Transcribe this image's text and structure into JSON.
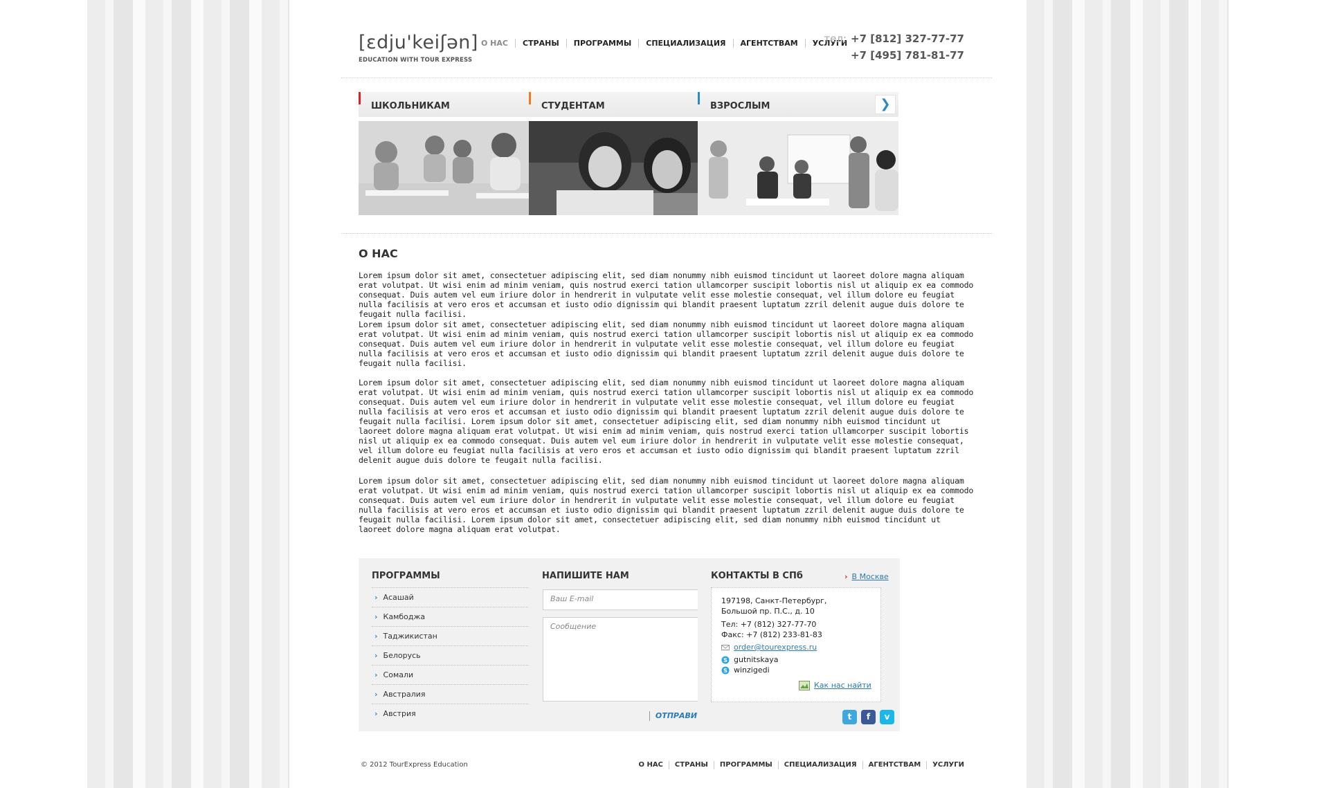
{
  "header": {
    "logo_text": "[ɛdju'keiʃən]",
    "logo_sub": "EDUCATION WITH TOUR EXPRESS",
    "nav": [
      "О НАС",
      "СТРАНЫ",
      "ПРОГРАММЫ",
      "СПЕЦИАЛИЗАЦИЯ",
      "АГЕНТСТВАМ",
      "УСЛУГИ"
    ],
    "phone_label": "тел:",
    "phone1": "+7 [812] 327-77-77",
    "phone2": "+7 [495] 781-81-77"
  },
  "categories": [
    {
      "title": "ШКОЛЬНИКАМ",
      "color": "#d8232a",
      "arrow": "❯"
    },
    {
      "title": "СТУДЕНТАМ",
      "color": "#f07a1f",
      "arrow": "❯"
    },
    {
      "title": "ВЗРОСЛЫМ",
      "color": "#2a8bc4",
      "arrow": "❯"
    }
  ],
  "content": {
    "heading": "О НАС",
    "paragraphs": [
      "Lorem ipsum dolor sit amet, consectetuer adipiscing elit, sed diam nonummy nibh euismod tincidunt ut laoreet dolore magna aliquam erat volutpat. Ut wisi enim ad minim veniam, quis nostrud exerci tation ullamcorper suscipit lobortis nisl ut aliquip ex ea commodo consequat. Duis autem vel eum iriure dolor in hendrerit in vulputate velit esse molestie consequat, vel illum dolore eu feugiat nulla facilisis at vero eros et accumsan et iusto odio dignissim qui blandit praesent luptatum zzril delenit augue duis dolore te feugait nulla facilisi.",
      "Lorem ipsum dolor sit amet, consectetuer adipiscing elit, sed diam nonummy nibh euismod tincidunt ut laoreet dolore magna aliquam erat volutpat. Ut wisi enim ad minim veniam, quis nostrud exerci tation ullamcorper suscipit lobortis nisl ut aliquip ex ea commodo consequat. Duis autem vel eum iriure dolor in hendrerit in vulputate velit esse molestie consequat, vel illum dolore eu feugiat nulla facilisis at vero eros et accumsan et iusto odio dignissim qui blandit praesent luptatum zzril delenit augue duis dolore te feugait nulla facilisi.",
      "Lorem ipsum dolor sit amet, consectetuer adipiscing elit, sed diam nonummy nibh euismod tincidunt ut laoreet dolore magna aliquam erat volutpat. Ut wisi enim ad minim veniam, quis nostrud exerci tation ullamcorper suscipit lobortis nisl ut aliquip ex ea commodo consequat. Duis autem vel eum iriure dolor in hendrerit in vulputate velit esse molestie consequat, vel illum dolore eu feugiat nulla facilisis at vero eros et accumsan et iusto odio dignissim qui blandit praesent luptatum zzril delenit augue duis dolore te feugait nulla facilisi. Lorem ipsum dolor sit amet, consectetuer adipiscing elit, sed diam nonummy nibh euismod tincidunt ut laoreet dolore magna aliquam erat volutpat. Ut wisi enim ad minim veniam, quis nostrud exerci tation ullamcorper suscipit lobortis nisl ut aliquip ex ea commodo consequat. Duis autem vel eum iriure dolor in hendrerit in vulputate velit esse molestie consequat, vel illum dolore eu feugiat nulla facilisis at vero eros et accumsan et iusto odio dignissim qui blandit praesent luptatum zzril delenit augue duis dolore te feugait nulla facilisi.",
      "Lorem ipsum dolor sit amet, consectetuer adipiscing elit, sed diam nonummy nibh euismod tincidunt ut laoreet dolore magna aliquam erat volutpat. Ut wisi enim ad minim veniam, quis nostrud exerci tation ullamcorper suscipit lobortis nisl ut aliquip ex ea commodo consequat. Duis autem vel eum iriure dolor in hendrerit in vulputate velit esse molestie consequat, vel illum dolore eu feugiat nulla facilisis at vero eros et accumsan et iusto odio dignissim qui blandit praesent luptatum zzril delenit augue duis dolore te feugait nulla facilisi. Lorem ipsum dolor sit amet, consectetuer adipiscing elit, sed diam nonummy nibh euismod tincidunt ut laoreet dolore magna aliquam erat volutpat."
    ]
  },
  "programs": {
    "title": "ПРОГРАММЫ",
    "items": [
      "Асашай",
      "Камбоджа",
      "Таджикистан",
      "Белорусь",
      "Сомали",
      "Австралия",
      "Австрия"
    ]
  },
  "write": {
    "title": "НАПИШИТЕ НАМ",
    "email_placeholder": "Ваш E-mail",
    "message_placeholder": "Сообщение",
    "send_label": "ОТПРАВИТЬ"
  },
  "contacts": {
    "title": "КОНТАКТЫ В СПб",
    "moscow_link": "В Москве",
    "address1": "197198, Санкт-Петербург,",
    "address2": "Большой пр. П.С., д. 10",
    "tel": "Тел:   +7 (812) 327-77-70",
    "fax": "Факс: +7 (812) 233-81-83",
    "email": "order@tourexpress.ru",
    "skype1": "gutnitskaya",
    "skype2": "winzigedi",
    "map_link": "Как нас найти",
    "social": [
      {
        "icon": "twitter-icon",
        "color": "#3ea9de",
        "glyph": "t"
      },
      {
        "icon": "facebook-icon",
        "color": "#3b5998",
        "glyph": "f"
      },
      {
        "icon": "vimeo-icon",
        "color": "#1ab7ea",
        "glyph": "v"
      }
    ]
  },
  "footer": {
    "copyright": "© 2012 TourExpress Education",
    "nav": [
      "О НАС",
      "СТРАНЫ",
      "ПРОГРАММЫ",
      "СПЕЦИАЛИЗАЦИЯ",
      "АГЕНТСТВАМ",
      "УСЛУГИ"
    ]
  }
}
